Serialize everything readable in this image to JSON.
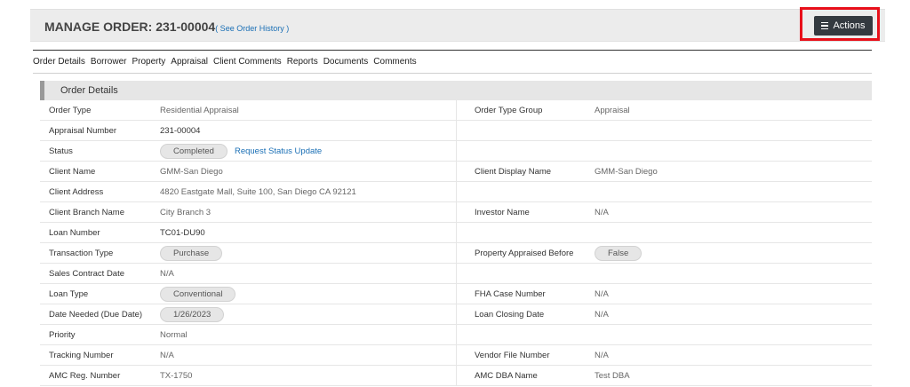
{
  "header": {
    "title_prefix": "MANAGE ORDER: ",
    "order_number": "231-00004",
    "history_link": "( See Order History )",
    "actions_label": "Actions"
  },
  "tabs": [
    "Order Details",
    "Borrower",
    "Property",
    "Appraisal",
    "Client Comments",
    "Reports",
    "Documents",
    "Comments"
  ],
  "section": {
    "title": "Order Details",
    "rows": [
      {
        "l_label": "Order Type",
        "l_value": "Residential Appraisal",
        "r_label": "Order Type Group",
        "r_value": "Appraisal"
      },
      {
        "l_label": "Appraisal Number",
        "l_value": "231-00004",
        "r_label": "",
        "r_value": ""
      },
      {
        "l_label": "Status",
        "l_value": "Completed",
        "l_link": "Request Status Update",
        "r_label": "",
        "r_value": ""
      },
      {
        "l_label": "Client Name",
        "l_value": "GMM-San Diego",
        "r_label": "Client Display Name",
        "r_value": "GMM-San Diego"
      },
      {
        "l_label": "Client Address",
        "l_value": "4820 Eastgate Mall, Suite 100, San Diego CA 92121",
        "r_label": "",
        "r_value": ""
      },
      {
        "l_label": "Client Branch Name",
        "l_value": "City Branch 3",
        "r_label": "Investor Name",
        "r_value": "N/A"
      },
      {
        "l_label": "Loan Number",
        "l_value": "TC01-DU90",
        "r_label": "",
        "r_value": ""
      },
      {
        "l_label": "Transaction Type",
        "l_value": "Purchase",
        "r_label": "Property Appraised Before",
        "r_value": "False"
      },
      {
        "l_label": "Sales Contract Date",
        "l_value": "N/A",
        "r_label": "",
        "r_value": ""
      },
      {
        "l_label": "Loan Type",
        "l_value": "Conventional",
        "r_label": "FHA Case Number",
        "r_value": "N/A"
      },
      {
        "l_label": "Date Needed (Due Date)",
        "l_value": "1/26/2023",
        "r_label": "Loan Closing Date",
        "r_value": "N/A"
      },
      {
        "l_label": "Priority",
        "l_value": "Normal",
        "r_label": "",
        "r_value": ""
      },
      {
        "l_label": "Tracking Number",
        "l_value": "N/A",
        "r_label": "Vendor File Number",
        "r_value": "N/A"
      },
      {
        "l_label": "AMC Reg. Number",
        "l_value": "TX-1750",
        "r_label": "AMC DBA Name",
        "r_value": "Test DBA"
      }
    ]
  }
}
